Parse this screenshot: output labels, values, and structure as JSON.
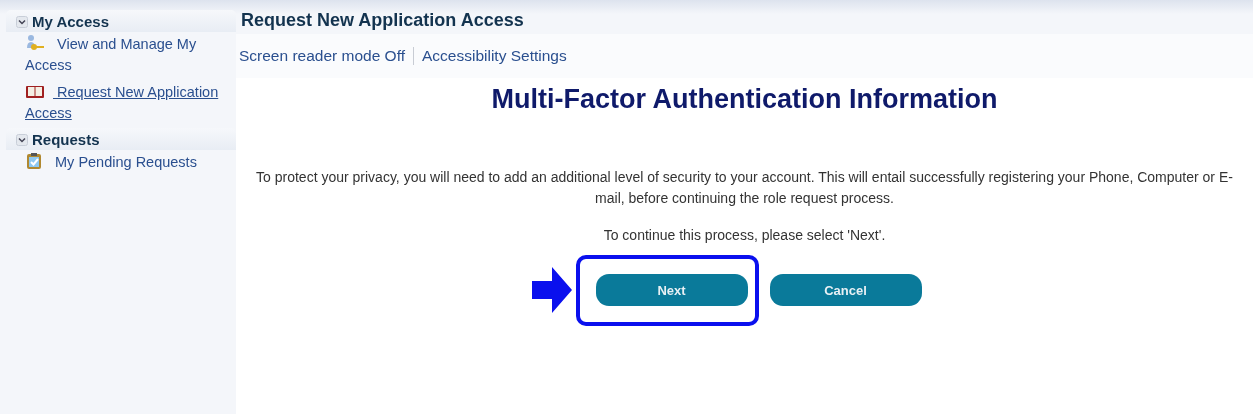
{
  "sidebar": {
    "sections": [
      {
        "title": "My Access",
        "expanded": true,
        "items": [
          {
            "label": "View and Manage My Access",
            "kind": "key",
            "selected": false
          },
          {
            "label": "Request New Application Access",
            "kind": "book",
            "selected": true
          }
        ]
      },
      {
        "title": "Requests",
        "expanded": true,
        "items": [
          {
            "label": "My Pending Requests",
            "kind": "clipboard",
            "selected": false
          }
        ]
      }
    ]
  },
  "page_title": "Request New Application Access",
  "toolbar": [
    "Screen reader mode Off",
    "Accessibility Settings"
  ],
  "heading": "Multi-Factor Authentication Information",
  "paragraphs": [
    "To protect your privacy, you will need to add an additional level of security to your account. This will entail successfully registering your Phone, Computer or E-mail, before continuing the role request process.",
    "To continue this process, please select 'Next'."
  ],
  "buttons": [
    {
      "label": "Next",
      "highlighted": true
    },
    {
      "label": "Cancel",
      "highlighted": false
    }
  ]
}
